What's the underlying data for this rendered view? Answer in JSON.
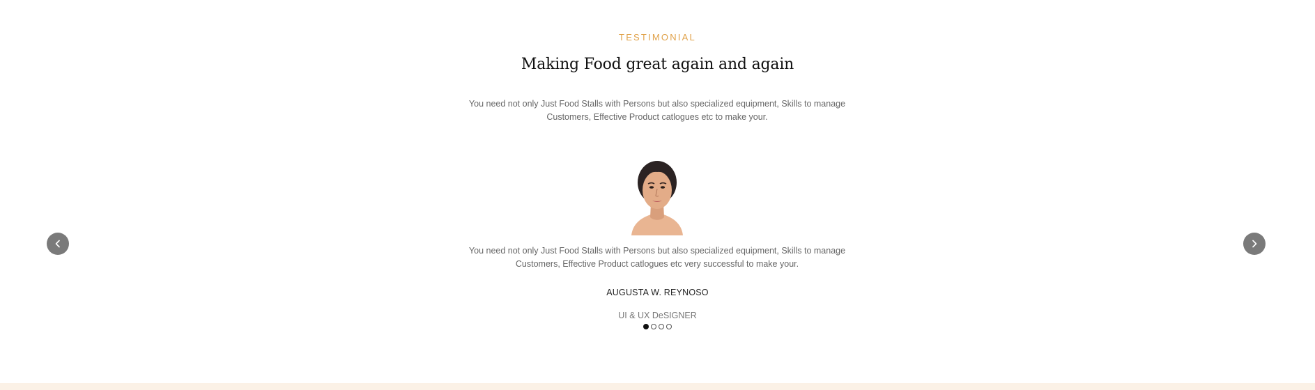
{
  "section": {
    "eyebrow": "TESTIMONIAL",
    "title": "Making Food great again and again",
    "intro": "You need not only Just Food Stalls with Persons but also specialized equipment, Skills to manage Customers, Effective Product catlogues etc to make your."
  },
  "testimonial": {
    "quote": "You need not only Just Food Stalls with Persons but also specialized equipment, Skills to manage Customers, Effective Product catlogues etc very successful to make your.",
    "name": "AUGUSTA W. REYNOSO",
    "role": "UI & UX DeSIGNER",
    "avatar_icon": "woman-portrait"
  },
  "carousel": {
    "prev_icon": "chevron-left-icon",
    "next_icon": "chevron-right-icon",
    "dots": [
      {
        "active": true
      },
      {
        "active": false
      },
      {
        "active": false
      },
      {
        "active": false
      }
    ]
  },
  "colors": {
    "accent": "#e0a24a",
    "nav_button": "#7a7a7a",
    "footer_band": "#fbf1e6"
  }
}
